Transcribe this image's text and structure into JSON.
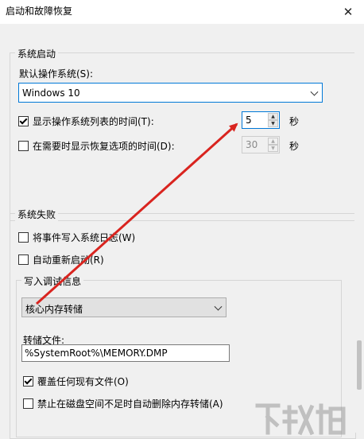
{
  "window": {
    "title": "启动和故障恢复",
    "close_glyph": "✕"
  },
  "system_startup": {
    "legend": "系统启动",
    "default_os_label": "默认操作系统(S):",
    "default_os_value": "Windows 10",
    "show_list_label": "显示操作系统列表的时间(T):",
    "show_list_checked": true,
    "show_list_value": "5",
    "show_list_unit": "秒",
    "show_recovery_label": "在需要时显示恢复选项的时间(D):",
    "show_recovery_checked": false,
    "show_recovery_value": "30",
    "show_recovery_unit": "秒"
  },
  "system_failure": {
    "legend": "系统失败",
    "write_event_label": "将事件写入系统日志(W)",
    "write_event_checked": false,
    "auto_restart_label": "自动重新启动(R)",
    "auto_restart_checked": false,
    "debug_info": {
      "legend": "写入调试信息",
      "dump_type_value": "核心内存转储",
      "dump_file_label": "转储文件:",
      "dump_file_value": "%SystemRoot%\\MEMORY.DMP",
      "overwrite_label": "覆盖任何现有文件(O)",
      "overwrite_checked": true,
      "disable_auto_delete_label": "禁止在磁盘空间不足时自动删除内存转储(A)",
      "disable_auto_delete_checked": false
    }
  },
  "colors": {
    "annotation_arrow": "#d9241f",
    "focus_border": "#0078d7"
  },
  "icons": {
    "close": "close-icon",
    "dropdown": "chevron-down-icon",
    "spin_up": "spin-up-icon",
    "spin_down": "spin-down-icon"
  }
}
